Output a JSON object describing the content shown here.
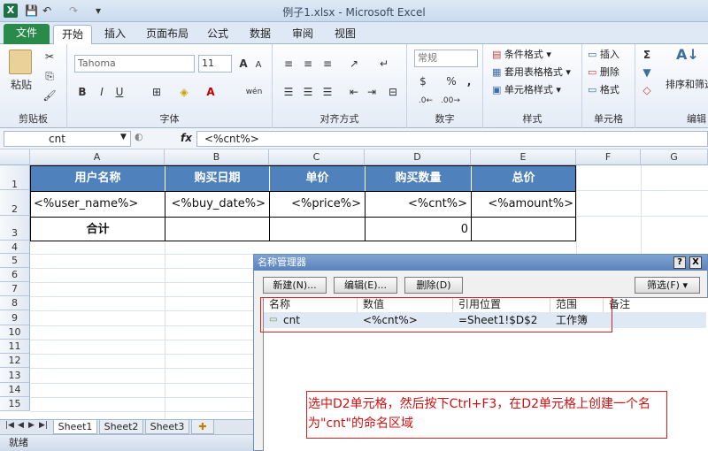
{
  "window": {
    "title": "例子1.xlsx - Microsoft Excel",
    "app_icon": "X"
  },
  "quick_access": {
    "save": "💾",
    "undo": "↶",
    "redo": "↷",
    "customize": "▾"
  },
  "tabs": [
    "文件",
    "开始",
    "插入",
    "页面布局",
    "公式",
    "数据",
    "审阅",
    "视图"
  ],
  "ribbon": {
    "clipboard": {
      "paste": "粘贴",
      "label": "剪贴板"
    },
    "font": {
      "name": "Tahoma",
      "size": "11",
      "label": "字体",
      "bold": "B",
      "italic": "I",
      "underline": "U",
      "grow": "A",
      "shrink": "A",
      "wen": "wén"
    },
    "alignment": {
      "label": "对齐方式"
    },
    "number": {
      "format": "常规",
      "currency": "$",
      "percent": "%",
      "comma": ",",
      "label": "数字"
    },
    "styles": {
      "cond": "条件格式",
      "table": "套用表格格式",
      "cell": "单元格样式",
      "label": "样式"
    },
    "cells": {
      "insert": "插入",
      "delete": "删除",
      "format": "格式",
      "label": "单元格"
    },
    "editing": {
      "sum": "Σ",
      "sort": "排序和筛选",
      "label": "编辑"
    }
  },
  "formula_bar": {
    "name_box": "cnt",
    "fx": "fx",
    "formula": "<%cnt%>"
  },
  "grid": {
    "columns": [
      "A",
      "B",
      "C",
      "D",
      "E",
      "F",
      "G"
    ],
    "rows": [
      "1",
      "2",
      "3",
      "4",
      "5",
      "6",
      "7",
      "8",
      "9",
      "10",
      "11",
      "12",
      "13",
      "14",
      "15"
    ],
    "headers": [
      "用户名称",
      "购买日期",
      "单价",
      "购买数量",
      "总价"
    ],
    "row2": [
      "<%user_name%>",
      "<%buy_date%>",
      "<%price%>",
      "<%cnt%>",
      "<%amount%>"
    ],
    "row3": {
      "label": "合计",
      "d": "0"
    },
    "header_color": "#4f81bd"
  },
  "sheets": [
    "Sheet1",
    "Sheet2",
    "Sheet3"
  ],
  "status": "就绪",
  "dialog": {
    "title": "名称管理器",
    "help": "?",
    "close": "X",
    "buttons": {
      "new": "新建(N)...",
      "edit": "编辑(E)...",
      "delete": "删除(D)",
      "filter": "筛选(F) ▾"
    },
    "columns": [
      "名称",
      "数值",
      "引用位置",
      "范围",
      "备注"
    ],
    "row": {
      "name": "cnt",
      "value": "<%cnt%>",
      "ref": "=Sheet1!$D$2",
      "scope": "工作簿",
      "note": ""
    }
  },
  "annotation": "选中D2单元格，然后按下Ctrl+F3，在D2单元格上创建一个名为\"cnt\"的命名区域",
  "annotation_color": "#d01010"
}
